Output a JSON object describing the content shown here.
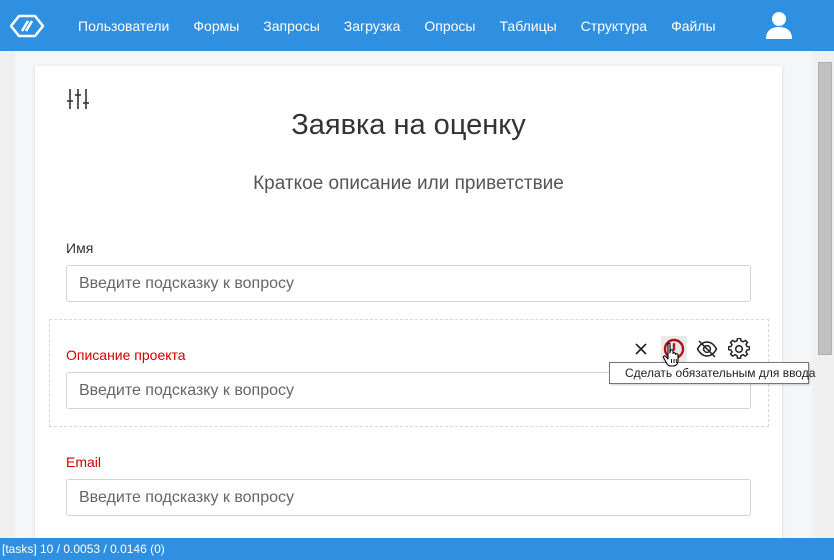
{
  "navbar": {
    "items": [
      "Пользователи",
      "Формы",
      "Запросы",
      "Загрузка",
      "Опросы",
      "Таблицы",
      "Структура",
      "Файлы"
    ]
  },
  "form": {
    "title": "Заявка на оценку",
    "subtitle": "Краткое описание или приветствие",
    "questions": [
      {
        "label": "Имя",
        "placeholder": "Введите подсказку к вопросу",
        "required": false
      },
      {
        "label": "Описание проекта",
        "placeholder": "Введите подсказку к вопросу",
        "required": true
      },
      {
        "label": "Email",
        "placeholder": "Введите подсказку к вопросу",
        "required": true
      }
    ]
  },
  "tooltip": {
    "text": "Сделать обязательным для ввода"
  },
  "statusbar": {
    "text": "[tasks] 10 / 0.0053 / 0.0146 (0)"
  },
  "colors": {
    "brand": "#2f8fe0",
    "required": "#d40000",
    "required_icon": "#b3121b"
  },
  "icons": {
    "logo": "app-logo-icon",
    "user": "user-icon",
    "form_settings": "sliders-icon",
    "delete": "close-icon",
    "required_toggle": "exclamation-circle-icon",
    "visibility": "eye-off-icon",
    "settings": "gear-icon"
  }
}
